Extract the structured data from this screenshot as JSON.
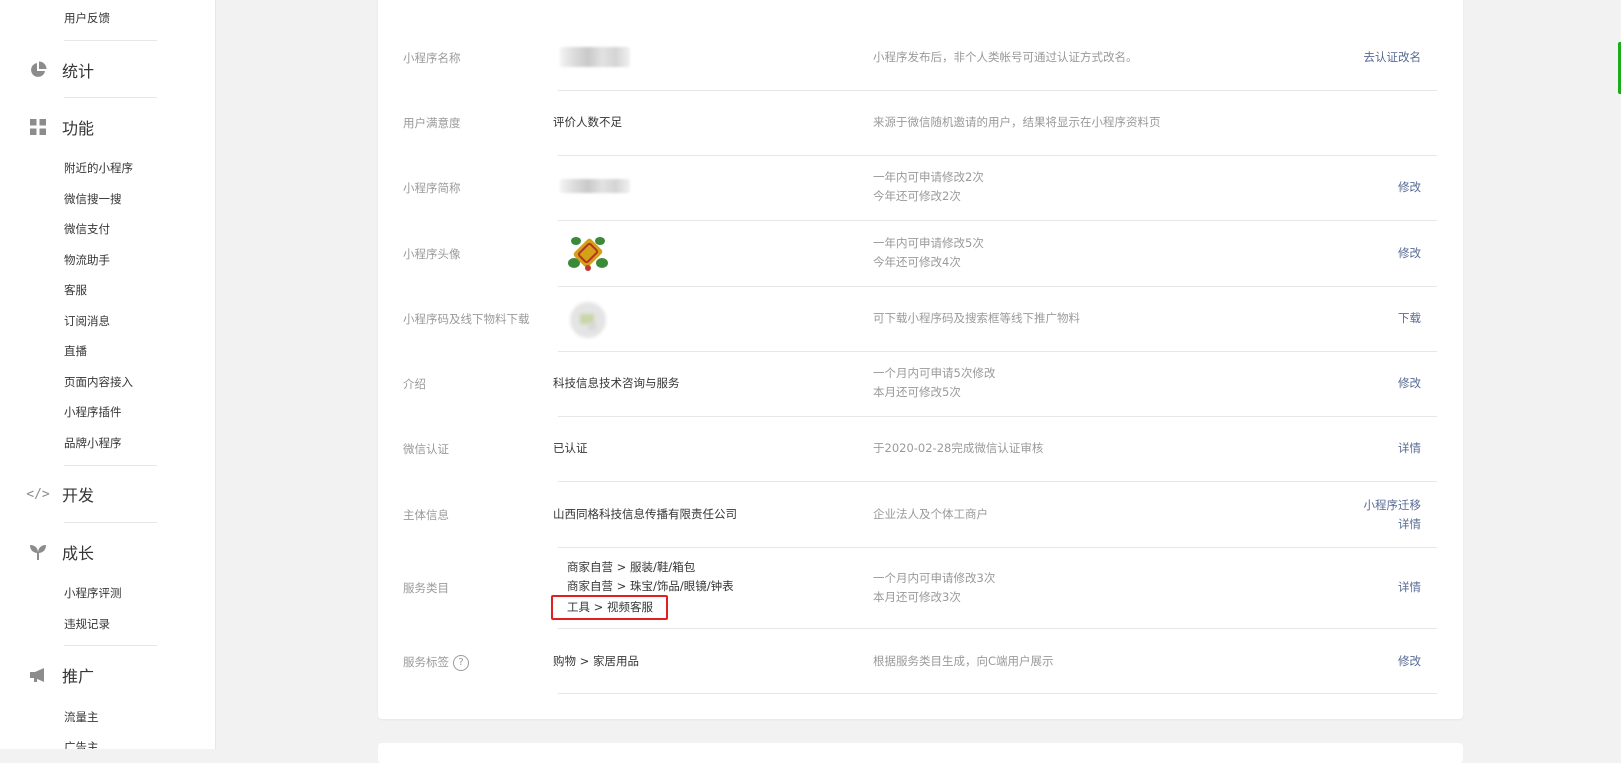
{
  "sidebar": {
    "top_item": "用户反馈",
    "sections": [
      {
        "label": "统计",
        "icon": "pie-chart-icon"
      },
      {
        "label": "功能",
        "icon": "grid-icon"
      },
      {
        "label": "开发",
        "icon": "code-icon"
      },
      {
        "label": "成长",
        "icon": "sprout-icon"
      },
      {
        "label": "推广",
        "icon": "megaphone-icon"
      }
    ],
    "feature_items": [
      "附近的小程序",
      "微信搜一搜",
      "微信支付",
      "物流助手",
      "客服",
      "订阅消息",
      "直播",
      "页面内容接入",
      "小程序插件",
      "品牌小程序"
    ],
    "growth_items": [
      "小程序评测",
      "违规记录"
    ],
    "promo_items": [
      "流量主",
      "广告主"
    ]
  },
  "rows": [
    {
      "label": "小程序名称",
      "value": "",
      "desc1": "小程序发布后，非个人类帐号可通过认证方式改名。",
      "desc2": "",
      "action1": "去认证改名",
      "action2": ""
    },
    {
      "label": "用户满意度",
      "value": "评价人数不足",
      "desc1": "来源于微信随机邀请的用户，结果将显示在小程序资料页",
      "desc2": "",
      "action1": "",
      "action2": ""
    },
    {
      "label": "小程序简称",
      "value": "",
      "desc1": "一年内可申请修改2次",
      "desc2": "今年还可修改2次",
      "action1": "修改",
      "action2": ""
    },
    {
      "label": "小程序头像",
      "value": "",
      "desc1": "一年内可申请修改5次",
      "desc2": "今年还可修改4次",
      "action1": "修改",
      "action2": ""
    },
    {
      "label": "小程序码及线下物料下载",
      "value": "",
      "desc1": "可下载小程序码及搜索框等线下推广物料",
      "desc2": "",
      "action1": "下载",
      "action2": ""
    },
    {
      "label": "介绍",
      "value": "科技信息技术咨询与服务",
      "desc1": "一个月内可申请5次修改",
      "desc2": "本月还可修改5次",
      "action1": "修改",
      "action2": ""
    },
    {
      "label": "微信认证",
      "value": "已认证",
      "desc1": "于2020-02-28完成微信认证审核",
      "desc2": "",
      "action1": "详情",
      "action2": ""
    },
    {
      "label": "主体信息",
      "value": "山西同格科技信息传播有限责任公司",
      "desc1": "企业法人及个体工商户",
      "desc2": "",
      "action1": "小程序迁移",
      "action2": "详情"
    },
    {
      "label": "服务类目",
      "values": [
        "商家自营 > 服装/鞋/箱包",
        "商家自营 > 珠宝/饰品/眼镜/钟表",
        "工具 > 视频客服"
      ],
      "desc1": "一个月内可申请修改3次",
      "desc2": "本月还可修改3次",
      "action1": "详情",
      "action2": ""
    },
    {
      "label": "服务标签",
      "help": "?",
      "value": "购物 > 家居用品",
      "desc1": "根据服务类目生成，向C端用户展示",
      "desc2": "",
      "action1": "修改",
      "action2": ""
    }
  ],
  "colors": {
    "link": "#576b95",
    "label": "#9a9a9a",
    "highlight": "#e02020",
    "accent": "#1aad19"
  }
}
